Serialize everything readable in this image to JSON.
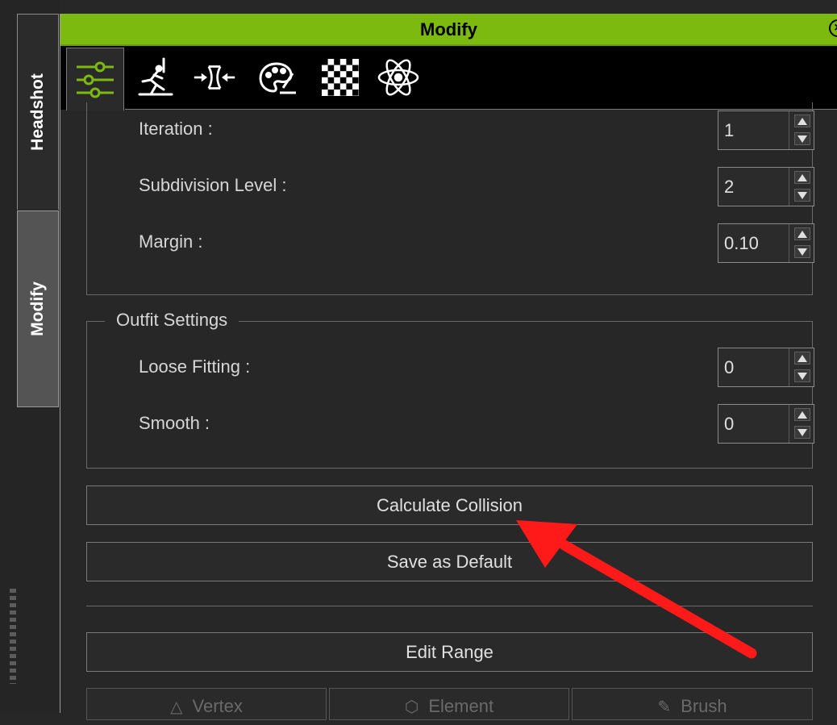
{
  "side_tabs": {
    "headshot": "Headshot",
    "modify": "Modify"
  },
  "panel": {
    "title": "Modify",
    "close_icon": "close-circle-icon"
  },
  "toolbar": {
    "items": [
      {
        "icon": "sliders-icon",
        "active": true
      },
      {
        "icon": "running-pose-icon",
        "active": false
      },
      {
        "icon": "compress-arrows-icon",
        "active": false
      },
      {
        "icon": "palette-icon",
        "active": false
      },
      {
        "icon": "checker-texture-icon",
        "active": false
      },
      {
        "icon": "atom-physics-icon",
        "active": false
      }
    ]
  },
  "collision": {
    "iteration_label": "Iteration :",
    "iteration_value": "1",
    "subdivision_label": "Subdivision Level :",
    "subdivision_value": "2",
    "margin_label": "Margin :",
    "margin_value": "0.10"
  },
  "outfit": {
    "legend": "Outfit Settings",
    "loose_label": "Loose Fitting :",
    "loose_value": "0",
    "smooth_label": "Smooth :",
    "smooth_value": "0"
  },
  "buttons": {
    "calculate": "Calculate Collision",
    "save_default": "Save as Default",
    "edit_range": "Edit Range"
  },
  "range_modes": {
    "vertex": "Vertex",
    "element": "Element",
    "brush": "Brush"
  },
  "colors": {
    "accent": "#7dba10",
    "annotation_arrow": "#ff1a1a"
  }
}
